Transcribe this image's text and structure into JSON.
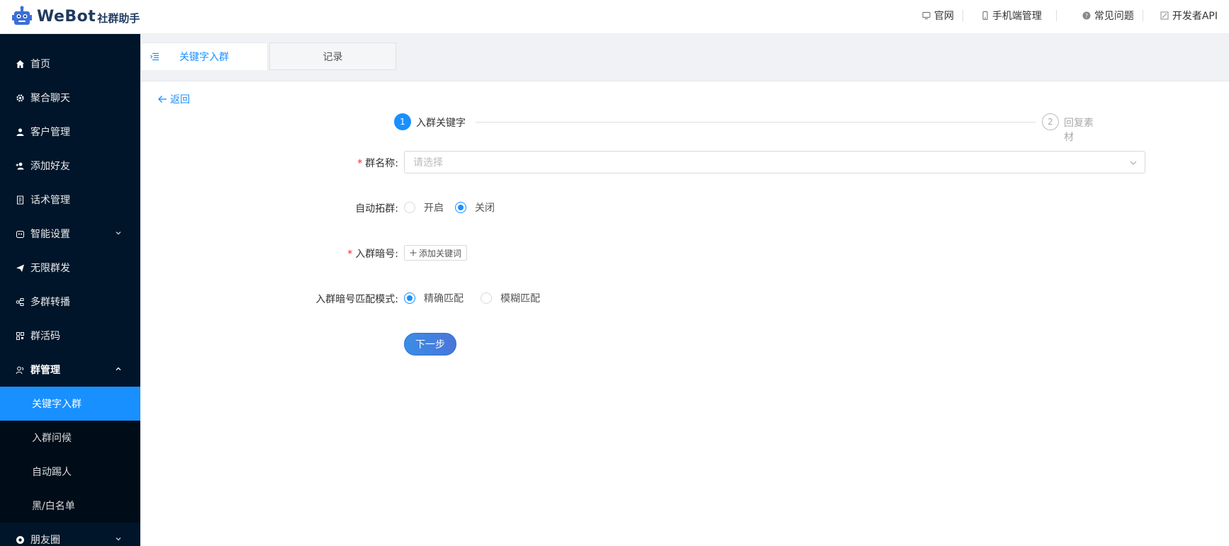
{
  "header": {
    "brand_main": "WeBot",
    "brand_sub": "社群助手",
    "links": [
      {
        "label": "官网",
        "icon": "monitor-icon"
      },
      {
        "label": "手机端管理",
        "icon": "mobile-icon"
      },
      {
        "label": "常见问题",
        "icon": "question-circle-icon"
      },
      {
        "label": "开发者API",
        "icon": "api-icon"
      }
    ]
  },
  "sidebar": {
    "items": [
      {
        "label": "首页",
        "icon": "home-icon"
      },
      {
        "label": "聚合聊天",
        "icon": "gear-icon"
      },
      {
        "label": "客户管理",
        "icon": "user-icon"
      },
      {
        "label": "添加好友",
        "icon": "user-add-icon"
      },
      {
        "label": "话术管理",
        "icon": "document-icon"
      },
      {
        "label": "智能设置",
        "icon": "robot-icon"
      },
      {
        "label": "无限群发",
        "icon": "send-icon"
      },
      {
        "label": "多群转播",
        "icon": "broadcast-icon"
      },
      {
        "label": "群活码",
        "icon": "qrcode-icon"
      },
      {
        "label": "群管理",
        "icon": "team-icon"
      }
    ],
    "group_submenu": [
      {
        "label": "关键字入群",
        "active": true
      },
      {
        "label": "入群问候",
        "active": false
      },
      {
        "label": "自动踢人",
        "active": false
      },
      {
        "label": "黑/白名单",
        "active": false
      }
    ],
    "last_item": {
      "label": "朋友圈",
      "icon": "moments-icon"
    }
  },
  "tabs": [
    {
      "label": "关键字入群",
      "active": true
    },
    {
      "label": "记录",
      "active": false
    }
  ],
  "back_label": "返回",
  "steps": [
    {
      "num": "1",
      "label": "入群关键字",
      "active": true
    },
    {
      "num": "2",
      "label": "回复素材",
      "active": false
    }
  ],
  "form": {
    "group_name_label": "群名称:",
    "group_name_placeholder": "请选择",
    "auto_expand_label": "自动拓群:",
    "auto_expand_options": [
      "开启",
      "关闭"
    ],
    "auto_expand_selected": "关闭",
    "keyword_label": "入群暗号:",
    "add_keyword_label": "添加关键词",
    "match_mode_label": "入群暗号匹配模式:",
    "match_mode_options": [
      "精确匹配",
      "模糊匹配"
    ],
    "match_mode_selected": "精确匹配",
    "next_label": "下一步"
  },
  "colors": {
    "sidebar_bg": "#001529",
    "submenu_bg": "#000c17",
    "accent": "#1890ff",
    "required": "#f5222d"
  }
}
